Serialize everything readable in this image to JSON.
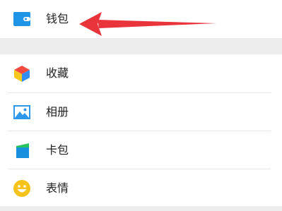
{
  "menu": {
    "wallet": {
      "label": "钱包",
      "icon": "wallet-icon"
    },
    "items": [
      {
        "label": "收藏",
        "icon": "favorites-cube-icon"
      },
      {
        "label": "相册",
        "icon": "album-image-icon"
      },
      {
        "label": "卡包",
        "icon": "card-wallet-icon"
      },
      {
        "label": "表情",
        "icon": "smiley-emoji-icon"
      }
    ]
  },
  "annotation": {
    "type": "arrow",
    "color": "#e8343a"
  },
  "colors": {
    "background": "#ededed",
    "row": "#ffffff",
    "wallet_icon": "#1f95e8",
    "album_icon": "#2e98ea",
    "emoji_icon": "#f6c21c",
    "card_icon_blue": "#1990dd",
    "card_icon_green": "#27c35c"
  }
}
